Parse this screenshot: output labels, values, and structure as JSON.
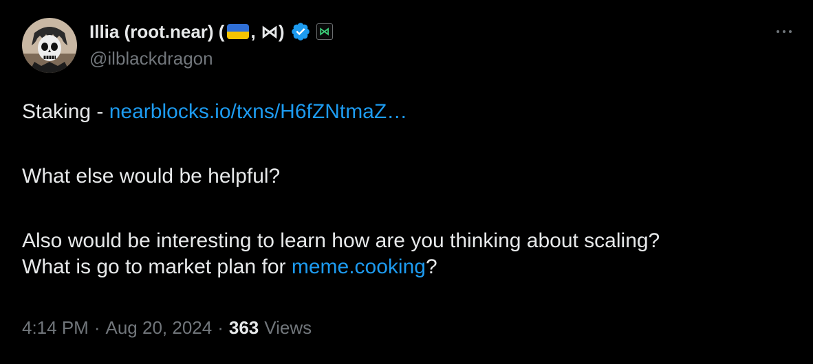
{
  "author": {
    "display_name_prefix": "Illia (root.near) (",
    "display_name_suffix": ", ⋈)",
    "handle": "@ilblackdragon",
    "flag_icon": "ukraine-flag-icon",
    "verified_icon": "verified-badge-icon",
    "affiliate_icon": "near-logo-badge-icon",
    "affiliate_glyph": "⋈"
  },
  "tweet": {
    "line1_prefix": "Staking - ",
    "line1_link": "nearblocks.io/txns/H6fZNtmaZ…",
    "line2": "What else would be helpful?",
    "line3": "Also would be interesting to learn how are you thinking about scaling?",
    "line4_prefix": "What is go to market plan for ",
    "line4_link": "meme.cooking",
    "line4_suffix": "?"
  },
  "meta": {
    "time": "4:14 PM",
    "separator": "·",
    "date": "Aug 20, 2024",
    "views_count": "363",
    "views_label": "Views"
  },
  "colors": {
    "background": "#000000",
    "text_primary": "#e7e9ea",
    "text_secondary": "#71767b",
    "link": "#1d9bf0",
    "verified": "#1d9bf0"
  },
  "icons": {
    "more": "more-horizontal-icon",
    "avatar": "avatar-image"
  }
}
